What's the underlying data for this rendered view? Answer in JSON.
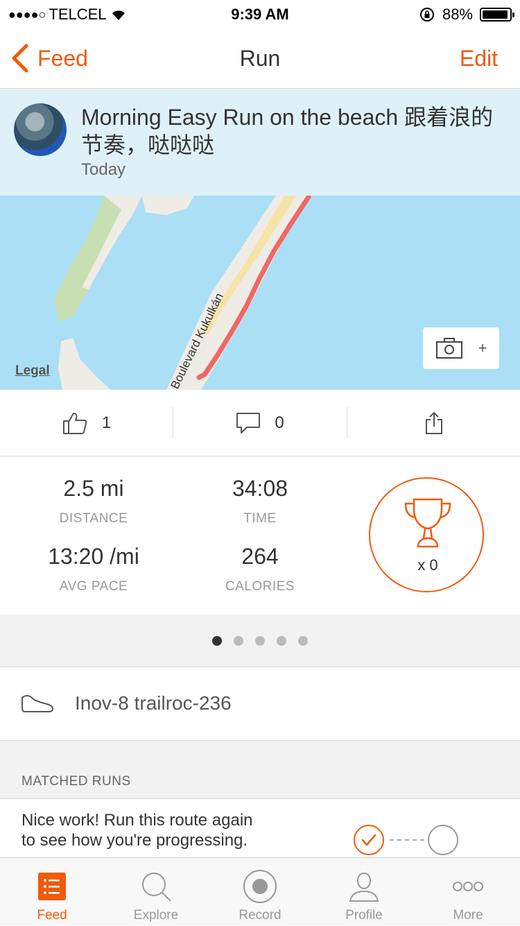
{
  "status_bar": {
    "carrier": "TELCEL",
    "signal_dots": "●●●●○",
    "time": "9:39 AM",
    "battery": "88%"
  },
  "nav": {
    "back_label": "Feed",
    "title": "Run",
    "edit_label": "Edit"
  },
  "activity": {
    "title": "Morning Easy Run on the beach 跟着浪的节奏，哒哒哒",
    "date": "Today"
  },
  "map": {
    "legal": "Legal",
    "street": "Boulevard Kukulkán",
    "add_photo": "+"
  },
  "social": {
    "likes": "1",
    "comments": "0"
  },
  "stats": {
    "distance_value": "2.5 mi",
    "distance_label": "DISTANCE",
    "time_value": "34:08",
    "time_label": "TIME",
    "pace_value": "13:20 /mi",
    "pace_label": "AVG PACE",
    "calories_value": "264",
    "calories_label": "CALORIES",
    "trophy_count": "x 0"
  },
  "pager": {
    "pages": 5,
    "active": 0
  },
  "gear": {
    "name": "Inov-8 trailroc-236"
  },
  "matched_runs": {
    "header": "MATCHED RUNS",
    "message": "Nice work! Run this route again to see how you're progressing."
  },
  "tabs": [
    {
      "label": "Feed",
      "icon": "list-icon"
    },
    {
      "label": "Explore",
      "icon": "search-icon"
    },
    {
      "label": "Record",
      "icon": "record-icon"
    },
    {
      "label": "Profile",
      "icon": "profile-icon"
    },
    {
      "label": "More",
      "icon": "more-icon"
    }
  ],
  "colors": {
    "accent": "#f15a0c",
    "header_bg": "#dff1f8",
    "water": "#aadff5",
    "route": "#f06767"
  }
}
